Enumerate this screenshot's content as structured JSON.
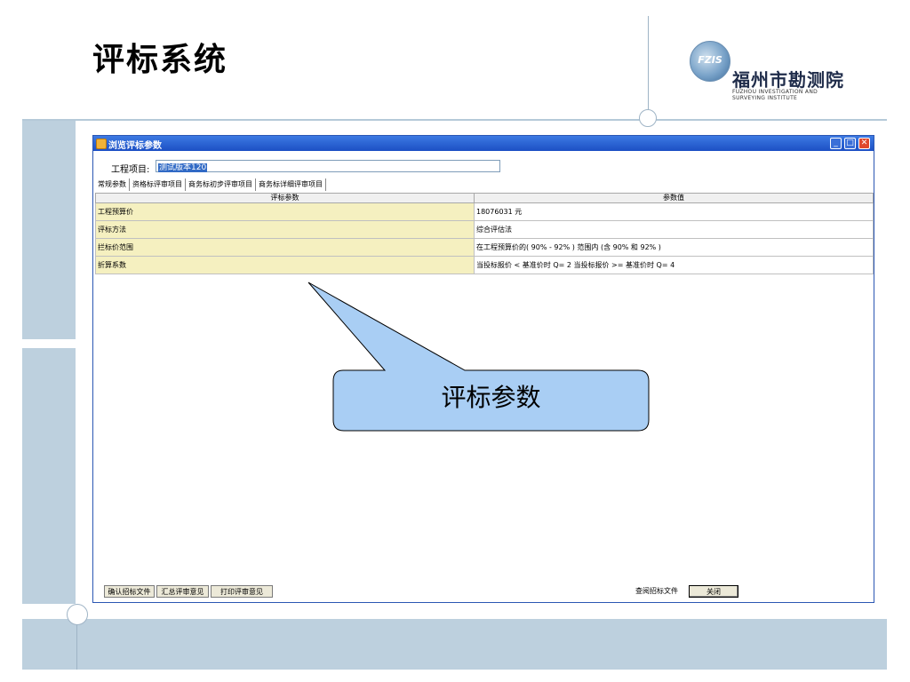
{
  "slide": {
    "title": "评标系统"
  },
  "logo": {
    "emblem_text": "FZIS",
    "name": "福州市勘测院",
    "en_line1": "FUZHOU INVESTIGATION AND",
    "en_line2": "SURVEYING INSTITUTE"
  },
  "window": {
    "title": "浏览评标参数",
    "project_label": "工程项目:",
    "project_value": "测试版本120",
    "tabs": [
      {
        "label": "常规参数"
      },
      {
        "label": "资格标评审项目"
      },
      {
        "label": "商务标初步评审项目"
      },
      {
        "label": "商务标详细评审项目"
      }
    ],
    "table": {
      "headers": [
        "评标参数",
        "参数值"
      ],
      "rows": [
        {
          "name": "工程预算价",
          "value": "18076031 元"
        },
        {
          "name": "评标方法",
          "value": "综合评估法"
        },
        {
          "name": "拦标价范围",
          "value": "在工程预算价的( 90% - 92% ) 范围内 (含 90% 和 92% )"
        },
        {
          "name": "折算系数",
          "value": "当投标报价 < 基准价时 Q= 2 当投标报价 >= 基准价时 Q= 4"
        }
      ]
    },
    "buttons": {
      "confirm": "确认招标文件",
      "summary": "汇总评审意见",
      "print": "打印评审意见",
      "view_doc": "查阅招标文件",
      "close": "关闭"
    }
  },
  "callout": {
    "text": "评标参数"
  },
  "colors": {
    "accent": "#bdd0de",
    "callout_fill": "#a9cef4",
    "name_cell": "#f5f0c0",
    "titlebar": "#2d64d4"
  }
}
